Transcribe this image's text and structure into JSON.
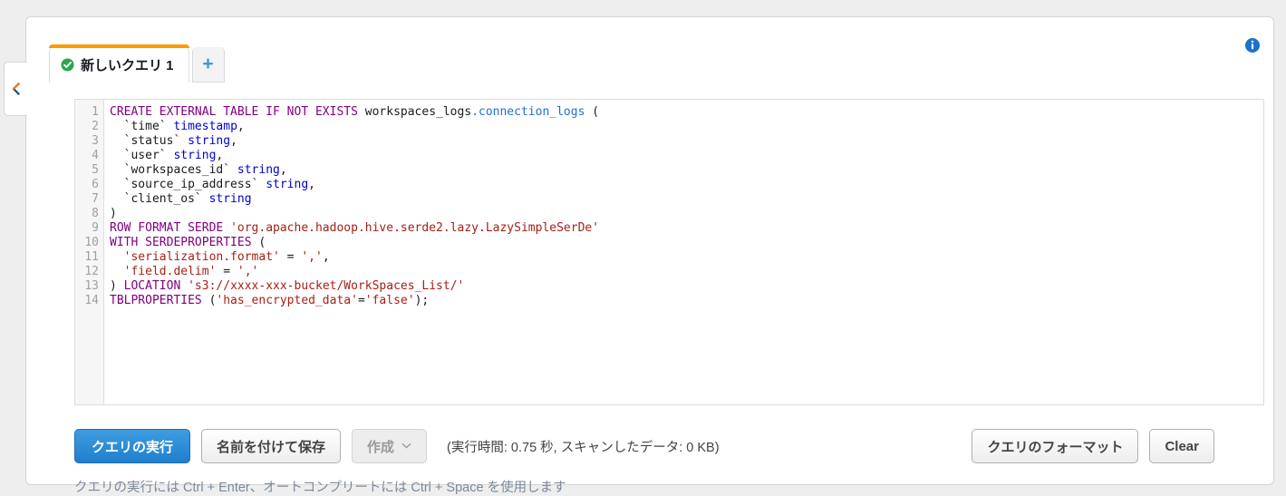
{
  "panel": {
    "collapse_handle_icon": "chevron-left-icon",
    "info_icon": "info-circle-icon"
  },
  "tabs": {
    "items": [
      {
        "label": "新しいクエリ 1",
        "status_icon": "check-circle-icon",
        "active": true
      }
    ],
    "add_label": "+"
  },
  "editor": {
    "line_numbers": [
      "1",
      "2",
      "3",
      "4",
      "5",
      "6",
      "7",
      "8",
      "9",
      "10",
      "11",
      "12",
      "13",
      "14"
    ],
    "lines": [
      [
        {
          "t": "CREATE EXTERNAL TABLE IF NOT EXISTS ",
          "c": "kw"
        },
        {
          "t": "workspaces_logs",
          "c": "ident"
        },
        {
          "t": ".connection_logs",
          "c": "blu"
        },
        {
          "t": " (",
          "c": "pun"
        }
      ],
      [
        {
          "t": "  `time` ",
          "c": "ident"
        },
        {
          "t": "timestamp",
          "c": "typ"
        },
        {
          "t": ",",
          "c": "pun"
        }
      ],
      [
        {
          "t": "  `status` ",
          "c": "ident"
        },
        {
          "t": "string",
          "c": "typ"
        },
        {
          "t": ",",
          "c": "pun"
        }
      ],
      [
        {
          "t": "  `user` ",
          "c": "ident"
        },
        {
          "t": "string",
          "c": "typ"
        },
        {
          "t": ",",
          "c": "pun"
        }
      ],
      [
        {
          "t": "  `workspaces_id` ",
          "c": "ident"
        },
        {
          "t": "string",
          "c": "typ"
        },
        {
          "t": ",",
          "c": "pun"
        }
      ],
      [
        {
          "t": "  `source_ip_address` ",
          "c": "ident"
        },
        {
          "t": "string",
          "c": "typ"
        },
        {
          "t": ",",
          "c": "pun"
        }
      ],
      [
        {
          "t": "  `client_os` ",
          "c": "ident"
        },
        {
          "t": "string",
          "c": "typ"
        }
      ],
      [
        {
          "t": ")",
          "c": "pun"
        }
      ],
      [
        {
          "t": "ROW FORMAT SERDE ",
          "c": "kw"
        },
        {
          "t": "'org.apache.hadoop.hive.serde2.lazy.LazySimpleSerDe'",
          "c": "str"
        }
      ],
      [
        {
          "t": "WITH SERDEPROPERTIES ",
          "c": "kw"
        },
        {
          "t": "(",
          "c": "pun"
        }
      ],
      [
        {
          "t": "  ",
          "c": "pun"
        },
        {
          "t": "'serialization.format'",
          "c": "str"
        },
        {
          "t": " = ",
          "c": "pun"
        },
        {
          "t": "','",
          "c": "str"
        },
        {
          "t": ",",
          "c": "pun"
        }
      ],
      [
        {
          "t": "  ",
          "c": "pun"
        },
        {
          "t": "'field.delim'",
          "c": "str"
        },
        {
          "t": " = ",
          "c": "pun"
        },
        {
          "t": "','",
          "c": "str"
        }
      ],
      [
        {
          "t": ") ",
          "c": "pun"
        },
        {
          "t": "LOCATION ",
          "c": "kw"
        },
        {
          "t": "'s3://xxxx-xxx-bucket/WorkSpaces_List/'",
          "c": "str"
        }
      ],
      [
        {
          "t": "TBLPROPERTIES ",
          "c": "kw"
        },
        {
          "t": "(",
          "c": "pun"
        },
        {
          "t": "'has_encrypted_data'",
          "c": "str"
        },
        {
          "t": "=",
          "c": "pun"
        },
        {
          "t": "'false'",
          "c": "str"
        },
        {
          "t": ");",
          "c": "pun"
        }
      ]
    ]
  },
  "actions": {
    "run_query_label": "クエリの実行",
    "save_as_label": "名前を付けて保存",
    "create_label": "作成",
    "create_caret_icon": "chevron-down-icon",
    "exec_stats": "(実行時間: 0.75 秒, スキャンしたデータ: 0 KB)",
    "format_query_label": "クエリのフォーマット",
    "clear_label": "Clear"
  },
  "hint": {
    "text": "クエリの実行には Ctrl + Enter、オートコンプリートには Ctrl + Space を使用します"
  },
  "colors": {
    "accent_orange": "#ff9900",
    "primary_blue": "#1f7fce",
    "status_green": "#2fa44f",
    "info_blue": "#1a73c8",
    "keyword_purple": "#800080",
    "type_blue": "#0000cd",
    "string_red": "#a52019",
    "page_bg": "#eeeeee"
  }
}
